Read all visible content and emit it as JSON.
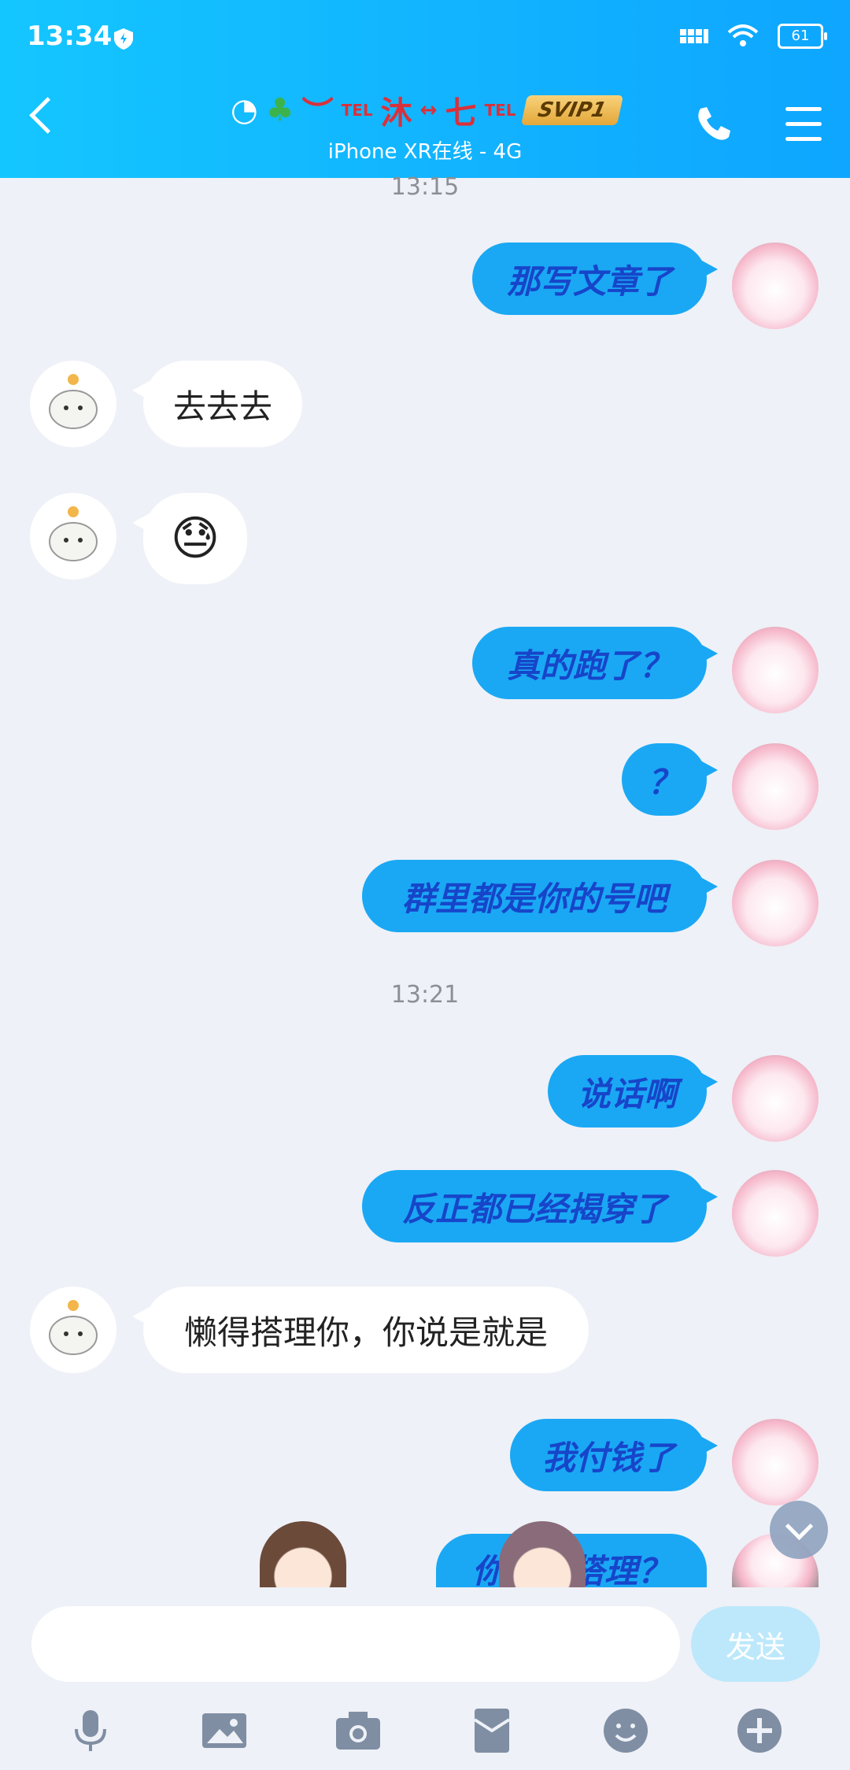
{
  "status_bar": {
    "time": "13:34",
    "battery": "61"
  },
  "header": {
    "contact_name_parts": [
      "︶",
      "TEL",
      "沐",
      "↔",
      "七",
      "TEL"
    ],
    "badge": "SVIP1",
    "subtitle": "iPhone XR在线 - 4G"
  },
  "timestamps": {
    "top": "13:15",
    "mid": "13:21"
  },
  "messages": [
    {
      "side": "out",
      "text": "那写文章了"
    },
    {
      "side": "in",
      "text": "去去去"
    },
    {
      "side": "in",
      "text": "",
      "emoji": "😓"
    },
    {
      "side": "out",
      "text": "真的跑了？"
    },
    {
      "side": "out",
      "text": "？"
    },
    {
      "side": "out",
      "text": "群里都是你的号吧"
    },
    {
      "side": "out",
      "text": "说话啊"
    },
    {
      "side": "out",
      "text": "反正都已经揭穿了"
    },
    {
      "side": "in",
      "text": "懒得搭理你，你说是就是"
    },
    {
      "side": "out",
      "text": "我付钱了"
    },
    {
      "side": "out",
      "text": "你……搭理？"
    }
  ],
  "composer": {
    "placeholder": "",
    "send_label": "发送"
  },
  "toolbar_icons": [
    "microphone-icon",
    "image-icon",
    "camera-icon",
    "red-packet-icon",
    "emoji-icon",
    "plus-icon"
  ],
  "colors": {
    "header": "#12b3ff",
    "bubble_out": "#1aa8f4",
    "bubble_text": "#1745c9",
    "background": "#eef1f7"
  }
}
